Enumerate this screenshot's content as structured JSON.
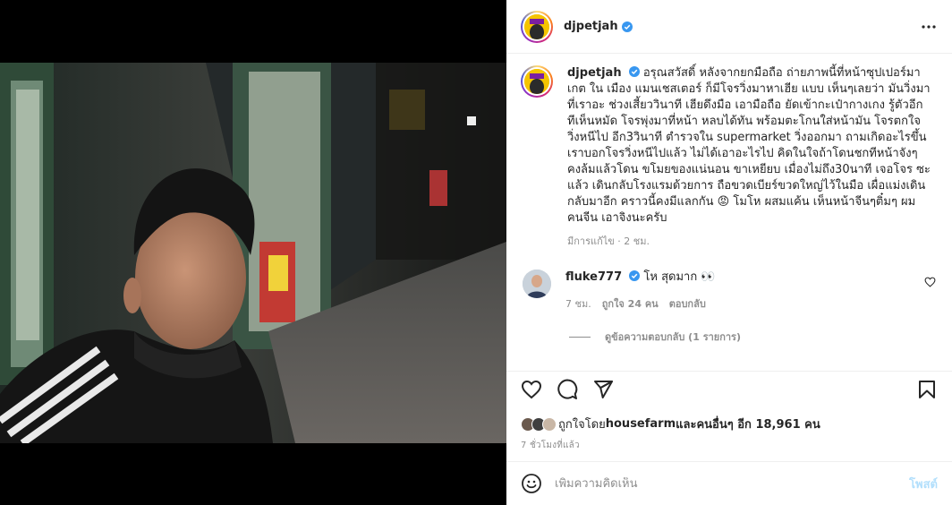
{
  "post": {
    "username": "djpetjah",
    "caption_username": "djpetjah",
    "caption_text": "อรุณสวัสดิ์ หลังจากยกมือถือ ถ่ายภาพนี้ที่หน้าซุปเปอร์มาเกต ใน เมือง แมนเชสเตอร์ ก็มีโจรวิ่งมาหาเฮีย แบบ เห็นๆเลยว่า มันวิ่งมาที่เราอะ ช่วงเสี้ยววินาที เฮียดึงมือ เอามือถือ ยัดเข้ากะเป๋ากางเกง รู้ตัวอีกทีเห็นหมัด โจรพุ่งมาที่หน้า หลบได้ทัน พร้อมตะโกนใส่หน้ามัน โจรตกใจวิ่งหนีไป อีก3วินาที ตำรวจใน supermarket วิ่งออกมา ถามเกิดอะไรขึ้น เราบอกโจรวิ่งหนีไปแล้ว ไม่ได้เอาอะไรไป คิดในใจถ้าโดนชกทีหน้าจังๆ คงล้มแล้วโดน ขโมยของแน่นอน ขาเหยียบ เมื่องไม่ถึง30นาที เจอโจร ซะแล้ว เดินกลับโรงแรมด้วยการ ถือขวดเบียร์ขวดใหญ่ไว้ในมือ เผื่อแม่งเดินกลับมาอีก คราวนี้คงมีแลกกัน 😡 โมโห ผสมแค้น เห็นหน้าจีนๆติ๋มๆ ผมคนจีน เอาจิงนะครับ",
    "edited_meta": "มีการแก้ไข · 2 ชม.",
    "likes_prefix": "ถูกใจโดย ",
    "likes_user": "housefarm",
    "likes_suffix": " และคนอื่นๆ อีก 18,961 คน",
    "time_ago": "7 ชั่วโมงที่แล้ว"
  },
  "comment": {
    "username": "fluke777",
    "text": "โห สุดมาก 👀",
    "time": "7 ชม.",
    "likes": "ถูกใจ 24 คน",
    "reply": "ตอบกลับ",
    "view_replies": "ดูข้อความตอบกลับ (1 รายการ)"
  },
  "add_comment": {
    "placeholder": "เพิ่มความคิดเห็น",
    "post_label": "โพสต์"
  },
  "icons": {
    "verified": "verified-badge-icon",
    "more": "more-options-icon",
    "like": "heart-icon",
    "comment": "comment-icon",
    "share": "share-icon",
    "save": "bookmark-icon",
    "emoji": "emoji-icon"
  },
  "colors": {
    "verified_blue": "#3897f0",
    "post_button": "#b2dffc",
    "muted": "#8e8e8e"
  }
}
